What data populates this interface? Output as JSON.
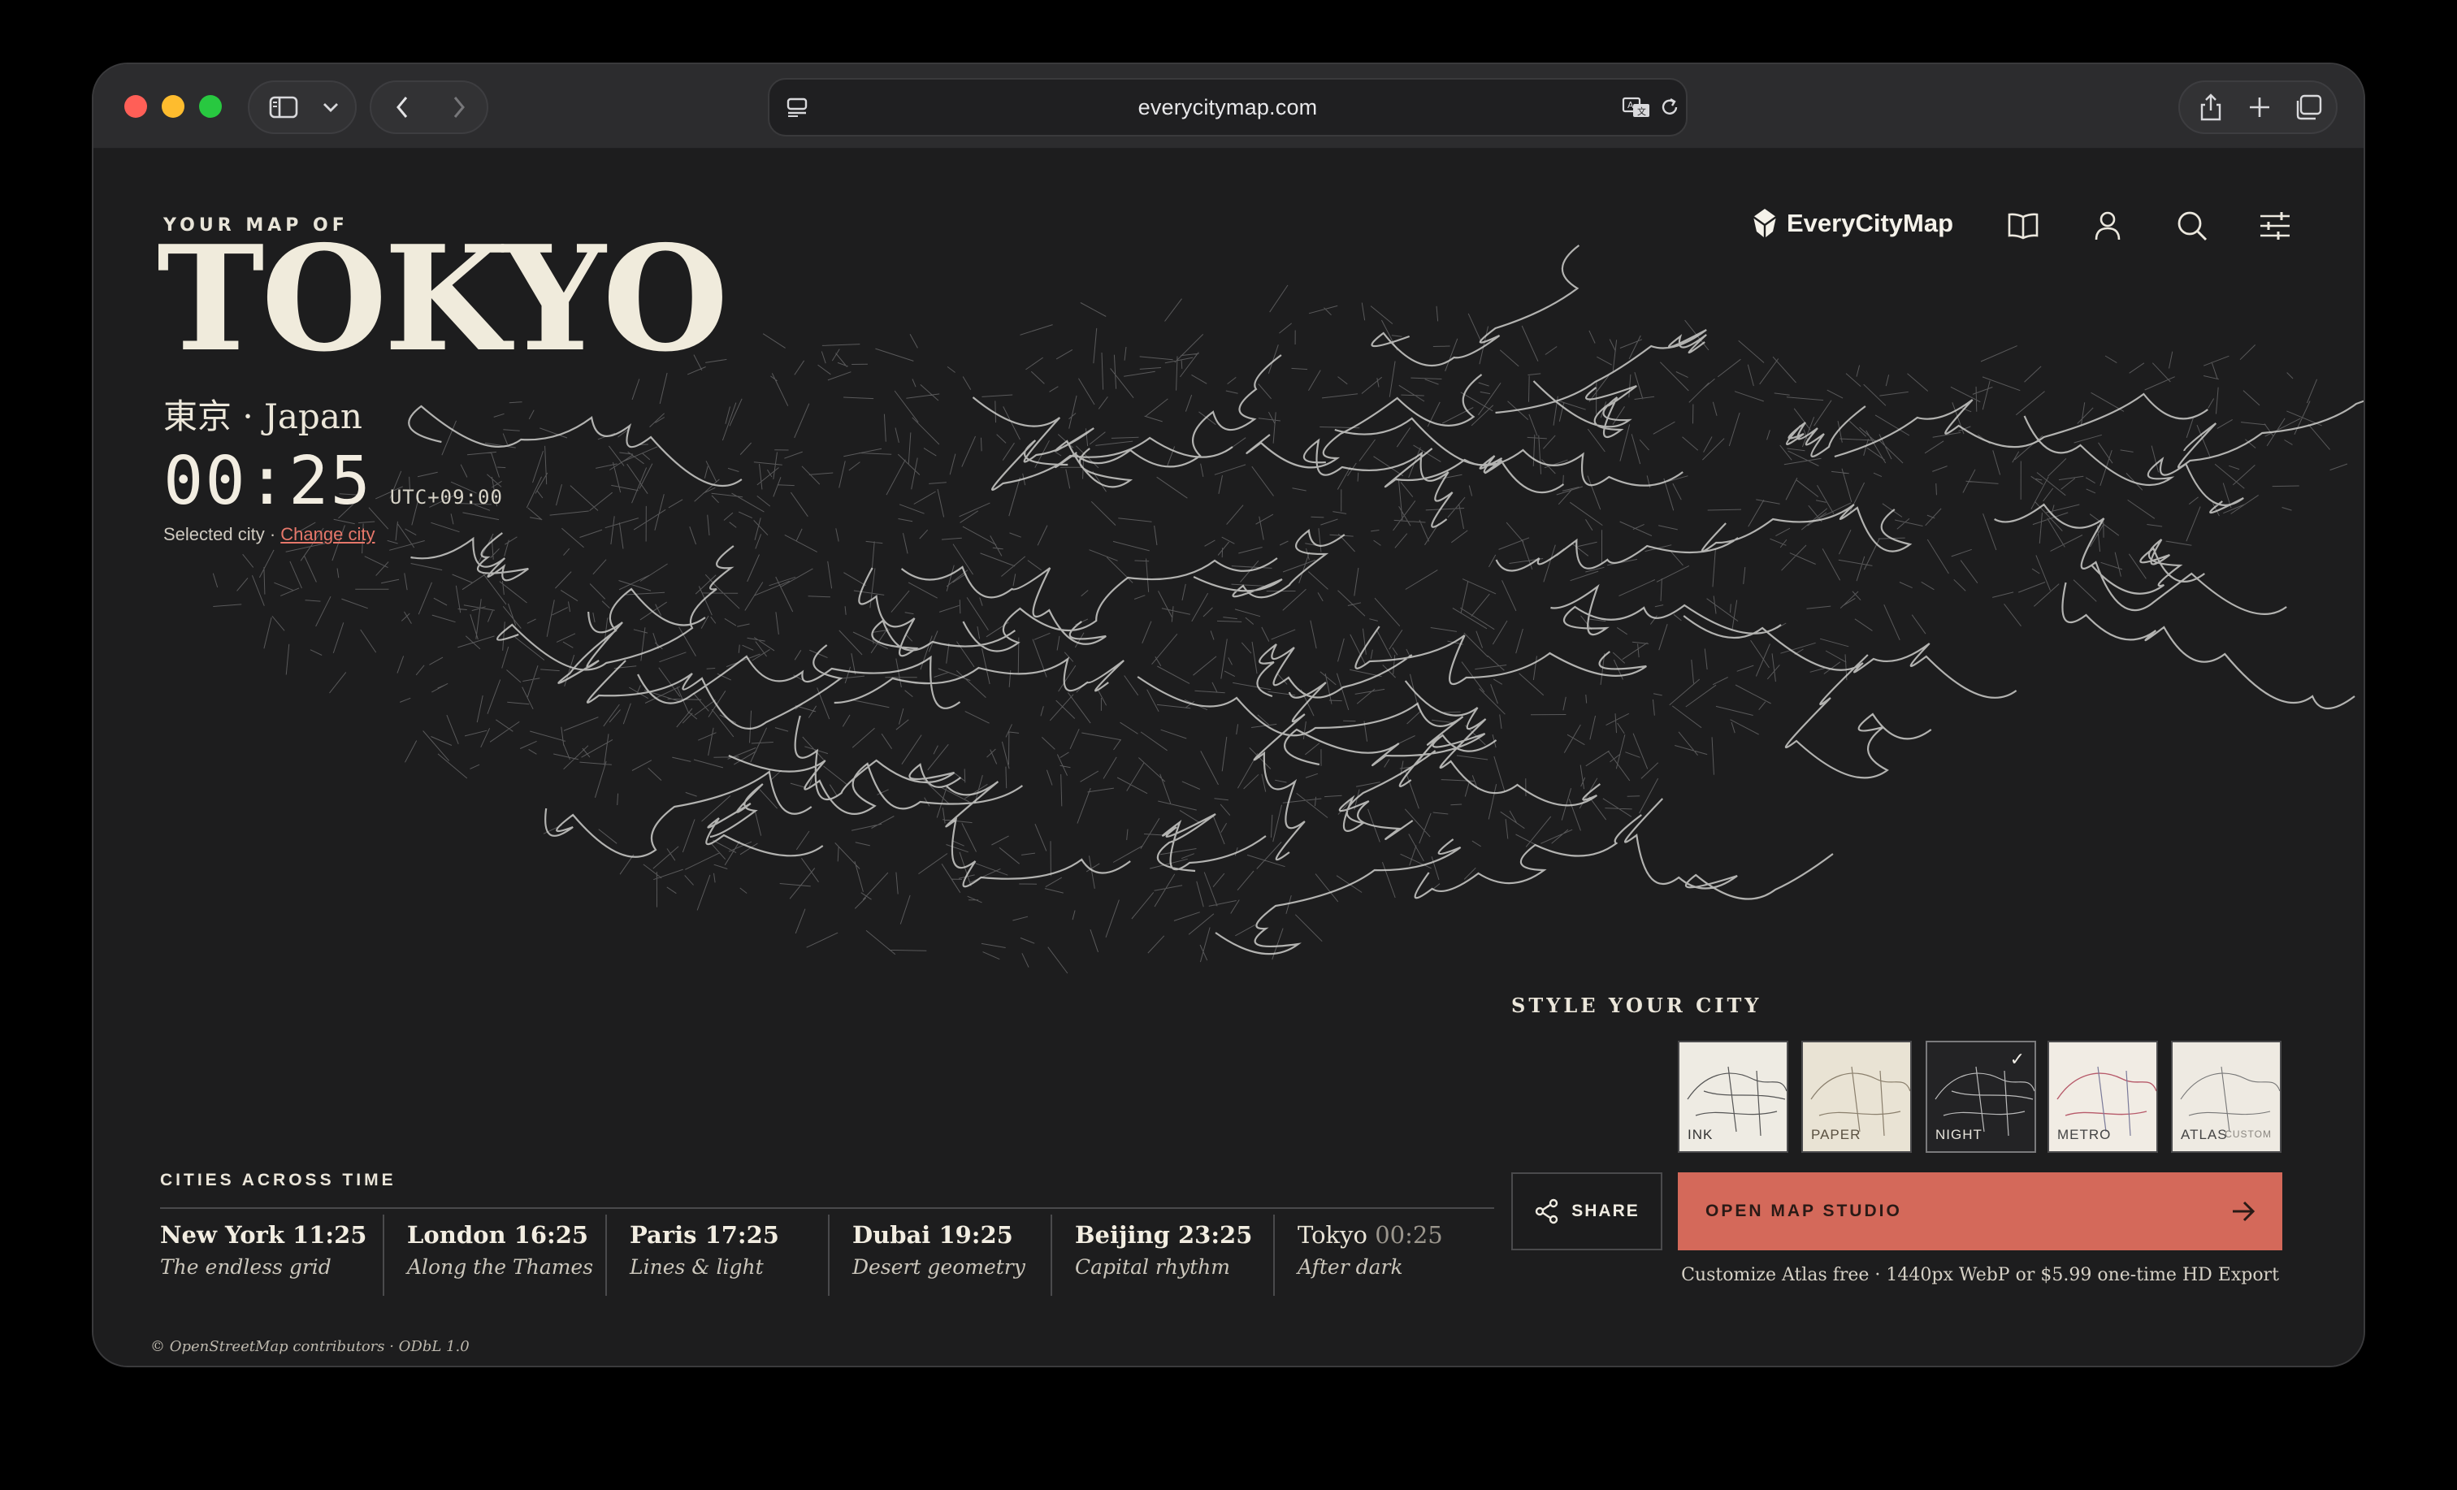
{
  "browser": {
    "url": "everycitymap.com"
  },
  "hero": {
    "eyebrow": "YOUR MAP OF",
    "city": "TOKYO",
    "subline": "東京 · Japan",
    "clock": "00:25",
    "utc": "UTC+09:00",
    "selected_label": "Selected city · ",
    "change_link": "Change city"
  },
  "nav": {
    "brand": "EveryCityMap",
    "icons": [
      "book-icon",
      "user-icon",
      "search-icon",
      "sliders-icon"
    ]
  },
  "style_section": {
    "title": "STYLE YOUR CITY",
    "styles": [
      {
        "label": "INK",
        "selected": false
      },
      {
        "label": "PAPER",
        "selected": false
      },
      {
        "label": "NIGHT",
        "selected": true
      },
      {
        "label": "METRO",
        "selected": false
      },
      {
        "label": "ATLAS",
        "sub": "CUSTOM",
        "selected": false
      }
    ]
  },
  "actions": {
    "share": "SHARE",
    "open_studio": "OPEN MAP STUDIO",
    "note": "Customize Atlas free · 1440px WebP or $5.99 one-time HD Export"
  },
  "cities_across_time": {
    "title": "CITIES ACROSS TIME",
    "cities": [
      {
        "name": "New York",
        "time": "11:25",
        "tag": "The endless grid"
      },
      {
        "name": "London",
        "time": "16:25",
        "tag": "Along the Thames"
      },
      {
        "name": "Paris",
        "time": "17:25",
        "tag": "Lines & light"
      },
      {
        "name": "Dubai",
        "time": "19:25",
        "tag": "Desert geometry"
      },
      {
        "name": "Beijing",
        "time": "23:25",
        "tag": "Capital rhythm"
      },
      {
        "name": "Tokyo",
        "time": "00:25",
        "tag": "After dark"
      }
    ]
  },
  "credit": "© OpenStreetMap contributors · ODbL 1.0",
  "colors": {
    "accent": "#d4695a",
    "background": "#1d1d1e",
    "cream": "#f0ebdc"
  }
}
